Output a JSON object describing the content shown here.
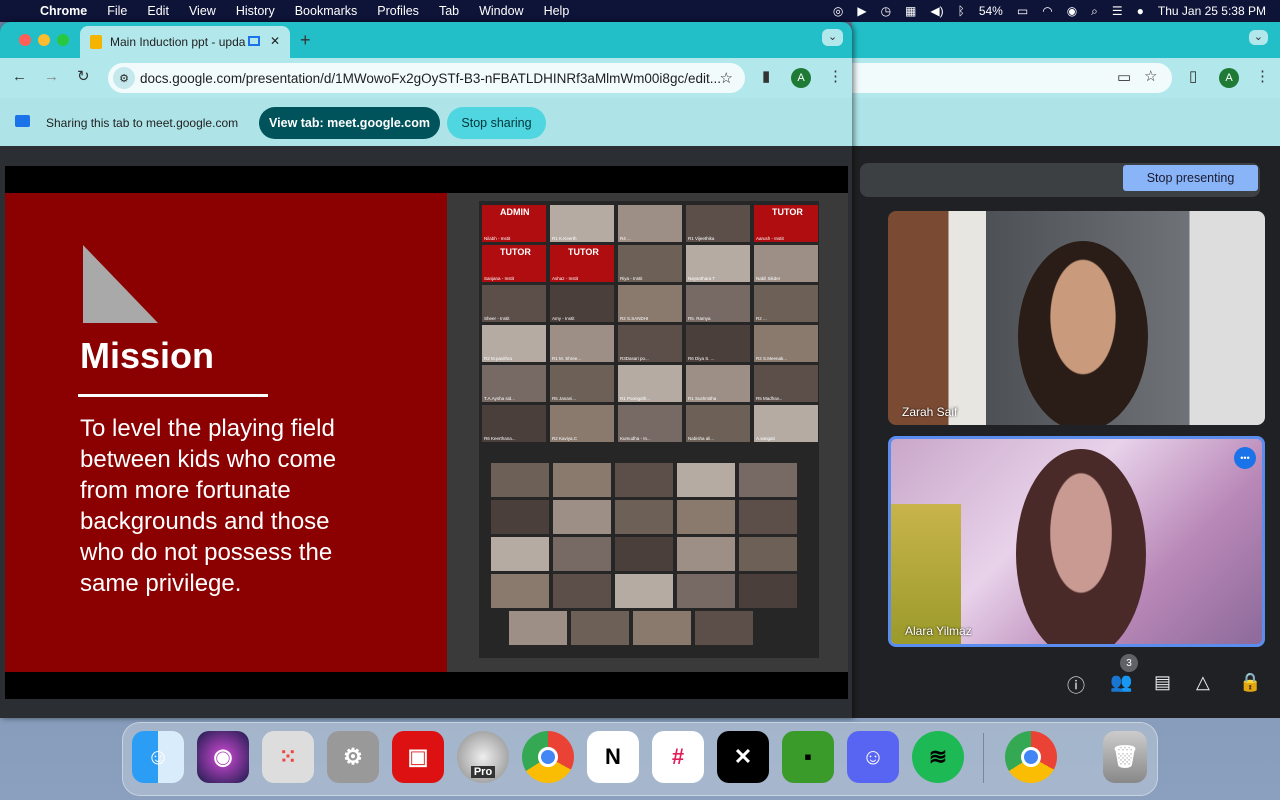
{
  "menubar": {
    "apple": "",
    "app": "Chrome",
    "items": [
      "File",
      "Edit",
      "View",
      "History",
      "Bookmarks",
      "Profiles",
      "Tab",
      "Window",
      "Help"
    ],
    "battery": "54%",
    "datetime": "Thu Jan 25  5:38 PM"
  },
  "browser": {
    "tab_title": "Main Induction ppt - upda",
    "new_tab": "+",
    "url": "docs.google.com/presentation/d/1MWowoFx2gOySTf-B3-nFBATLDHINRf3aMlmWm00i8gc/edit...",
    "avatar": "A"
  },
  "sharing": {
    "message": "Sharing this tab to meet.google.com",
    "view_tab": "View tab: meet.google.com",
    "stop": "Stop sharing"
  },
  "slide": {
    "title": "Mission",
    "body": "To level the playing field between kids who come from more fortunate backgrounds and those who do not possess the same privilege.",
    "tags": {
      "0": "ADMIN",
      "4": "TUTOR",
      "5": "TUTOR",
      "6": "TUTOR"
    },
    "names": [
      "Nilabh - Instit",
      "R1 K.Keerth",
      "R4 ...",
      "R1 Vijeethika",
      "Aarush - Instit",
      "Sanjana - Instit",
      "Ashaz - Instit",
      "Riya - Instit",
      "Nayanthara T",
      "Nabil Sikder",
      "Sheer - Instit",
      "Amy - Instit",
      "R2 S.SANDHI",
      "R5. Ramya",
      "R2 ...",
      "R2 M.pavithra",
      "R1 M. Shree...",
      "R3Dasari po...",
      "R6 Diya S. ...",
      "R2 S.Meenak...",
      "T.A.Aysha sid...",
      "R5 Janani...",
      "R1 Poongoth...",
      "R1 Sushmitha",
      "R5 Madhav...",
      "R6 Keerthana...",
      "R2 Kaviya.C",
      "Kumudha - In...",
      "Nabisha ali...",
      "A.sangati"
    ]
  },
  "meet": {
    "stop_presenting": "Stop presenting",
    "participants": [
      {
        "name": "Zarah Saif"
      },
      {
        "name": "Alara Yilmaz"
      }
    ],
    "people_count": "3",
    "more": "•••"
  },
  "dock": {
    "pro_label": "Pro"
  }
}
